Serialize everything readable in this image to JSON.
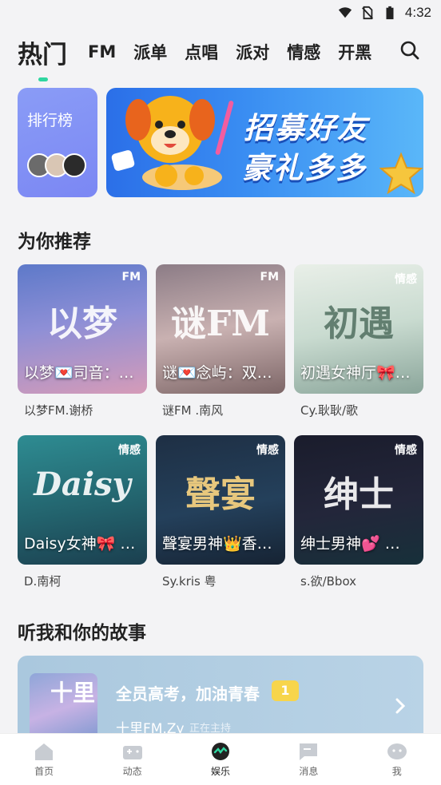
{
  "status_bar": {
    "time": "4:32"
  },
  "tabs": [
    {
      "label": "热门",
      "active": true
    },
    {
      "label": "FM"
    },
    {
      "label": "派单"
    },
    {
      "label": "点唱"
    },
    {
      "label": "派对"
    },
    {
      "label": "情感"
    },
    {
      "label": "开黑"
    }
  ],
  "rank_card": {
    "label": "排行榜"
  },
  "banner": {
    "line1": "招募好友",
    "line2": "豪礼多多"
  },
  "recommend": {
    "title": "为你推荐",
    "cards": [
      {
        "tag": "FM",
        "art": "以梦",
        "room": "以梦💌司音：…",
        "host": "以梦FM.谢桥"
      },
      {
        "tag": "FM",
        "art": "谜FM",
        "room": "谜💌念屿：双…",
        "host": "谜FM .南风"
      },
      {
        "tag": "情感",
        "art": "初遇",
        "room": "初遇女神厅🎀…",
        "host": "Cy.耿耿/歌"
      },
      {
        "tag": "情感",
        "art": "Daisy",
        "room": "Daisy女神🎀 …",
        "host": "D.南柯"
      },
      {
        "tag": "情感",
        "art": "聲宴",
        "room": "聲宴男神👑香…",
        "host": "Sy.kris 粤"
      },
      {
        "tag": "情感",
        "art": "绅士",
        "room": "绅士男神💕 …",
        "host": "s.欲/Bbox"
      }
    ]
  },
  "story": {
    "section_title": "听我和你的故事",
    "cover_text": "十里",
    "title": "全员高考，加油青春",
    "badge": "1",
    "anchor": "十里FM.Zy",
    "status": "正在主持"
  },
  "bottom_nav": [
    {
      "label": "首页",
      "icon": "home-icon"
    },
    {
      "label": "动态",
      "icon": "gamepad-icon"
    },
    {
      "label": "娱乐",
      "icon": "entertainment-icon",
      "active": true
    },
    {
      "label": "消息",
      "icon": "message-icon"
    },
    {
      "label": "我",
      "icon": "profile-icon"
    }
  ]
}
